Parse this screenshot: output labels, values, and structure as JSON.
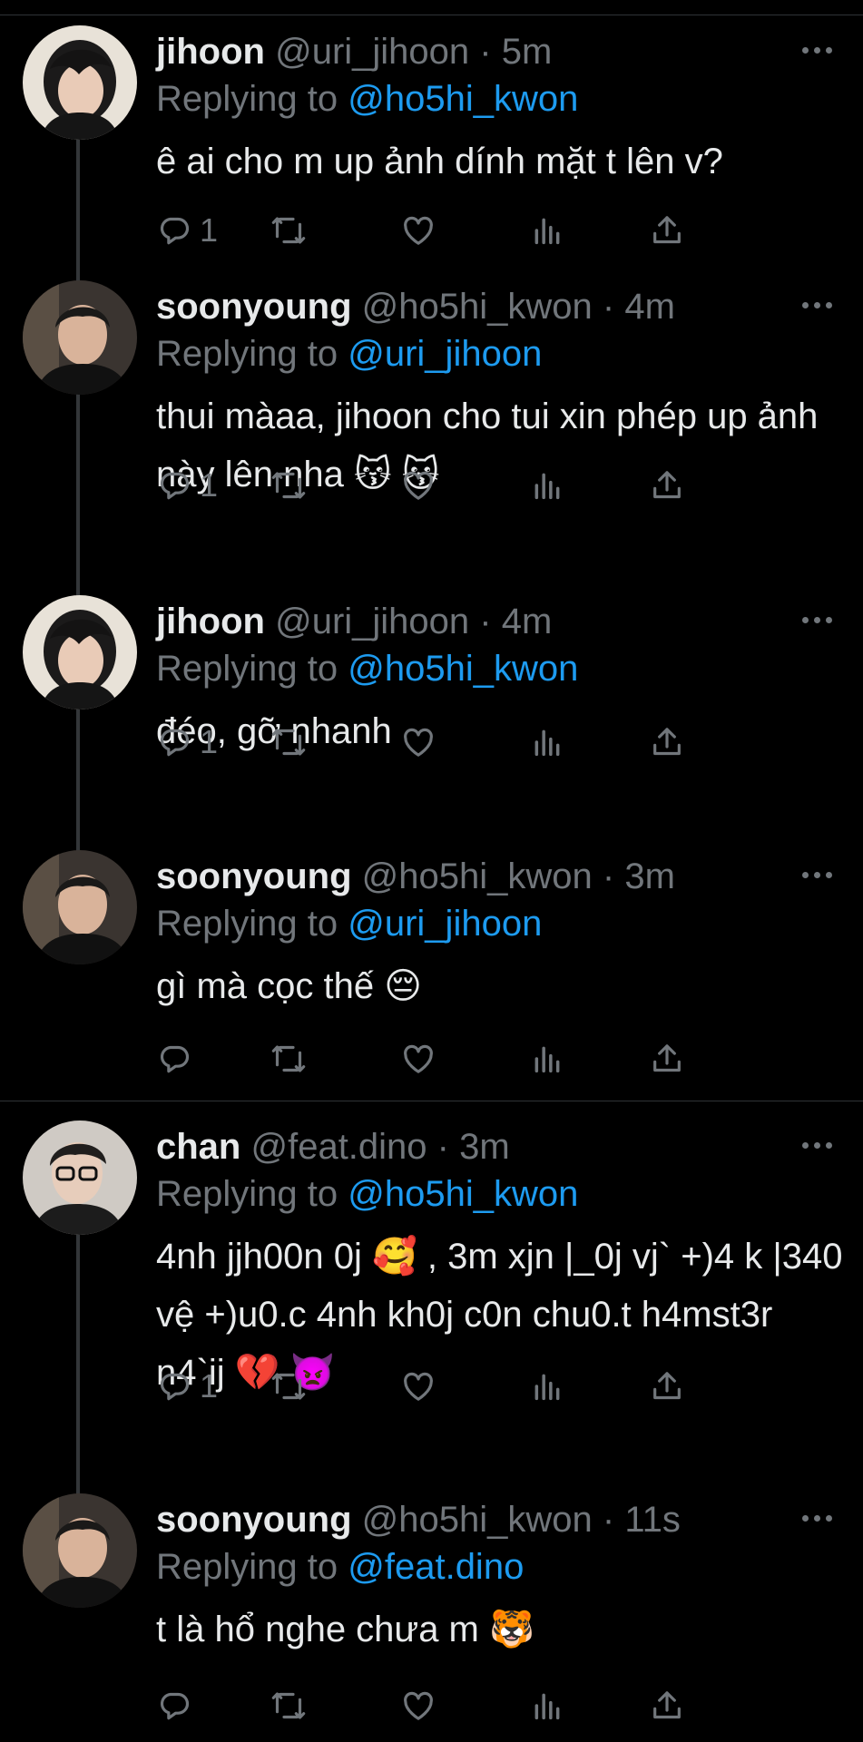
{
  "tweets": [
    {
      "name": "jihoon",
      "handle": "@uri_jihoon",
      "separator": "·",
      "time": "5m",
      "replying_prefix": "Replying to",
      "replying_to": "@ho5hi_kwon",
      "body": "ê ai cho m up ảnh dính mặt t lên v?",
      "reply_count": "1",
      "avatar_icon": "jihoon-avatar"
    },
    {
      "name": "soonyoung",
      "handle": "@ho5hi_kwon",
      "separator": "·",
      "time": "4m",
      "replying_prefix": "Replying to",
      "replying_to": "@uri_jihoon",
      "body": "thui màaa, jihoon cho tui xin phép up ảnh này lên nha 😽 😽",
      "reply_count": "1",
      "avatar_icon": "soonyoung-avatar"
    },
    {
      "name": "jihoon",
      "handle": "@uri_jihoon",
      "separator": "·",
      "time": "4m",
      "replying_prefix": "Replying to",
      "replying_to": "@ho5hi_kwon",
      "body": "đéo, gỡ nhanh",
      "reply_count": "1",
      "avatar_icon": "jihoon-avatar"
    },
    {
      "name": "soonyoung",
      "handle": "@ho5hi_kwon",
      "separator": "·",
      "time": "3m",
      "replying_prefix": "Replying to",
      "replying_to": "@uri_jihoon",
      "body": "gì mà cọc thế 😔",
      "reply_count": "",
      "avatar_icon": "soonyoung-avatar"
    },
    {
      "name": "chan",
      "handle": "@feat.dino",
      "separator": "·",
      "time": "3m",
      "replying_prefix": "Replying to",
      "replying_to": "@ho5hi_kwon",
      "body": "4nh jjh00n 0j 🥰 , 3m xjn |_0j vj` +)4 k |340 vệ +)u0.c 4nh kh0j c0n chu0.t h4mst3r n4`ij 💔 👿",
      "reply_count": "1",
      "avatar_icon": "chan-avatar"
    },
    {
      "name": "soonyoung",
      "handle": "@ho5hi_kwon",
      "separator": "·",
      "time": "11s",
      "replying_prefix": "Replying to",
      "replying_to": "@feat.dino",
      "body": "t là hổ nghe chưa m 🐯",
      "reply_count": "",
      "avatar_icon": "soonyoung-avatar"
    }
  ],
  "icons": {
    "reply": "reply-icon",
    "retweet": "retweet-icon",
    "like": "heart-icon",
    "views": "analytics-icon",
    "share": "share-icon",
    "more": "more-icon"
  },
  "colors": {
    "background": "#000000",
    "muted": "#71767b",
    "link": "#1d9bf0",
    "text": "#e7e9ea",
    "divider": "#2f3336"
  }
}
